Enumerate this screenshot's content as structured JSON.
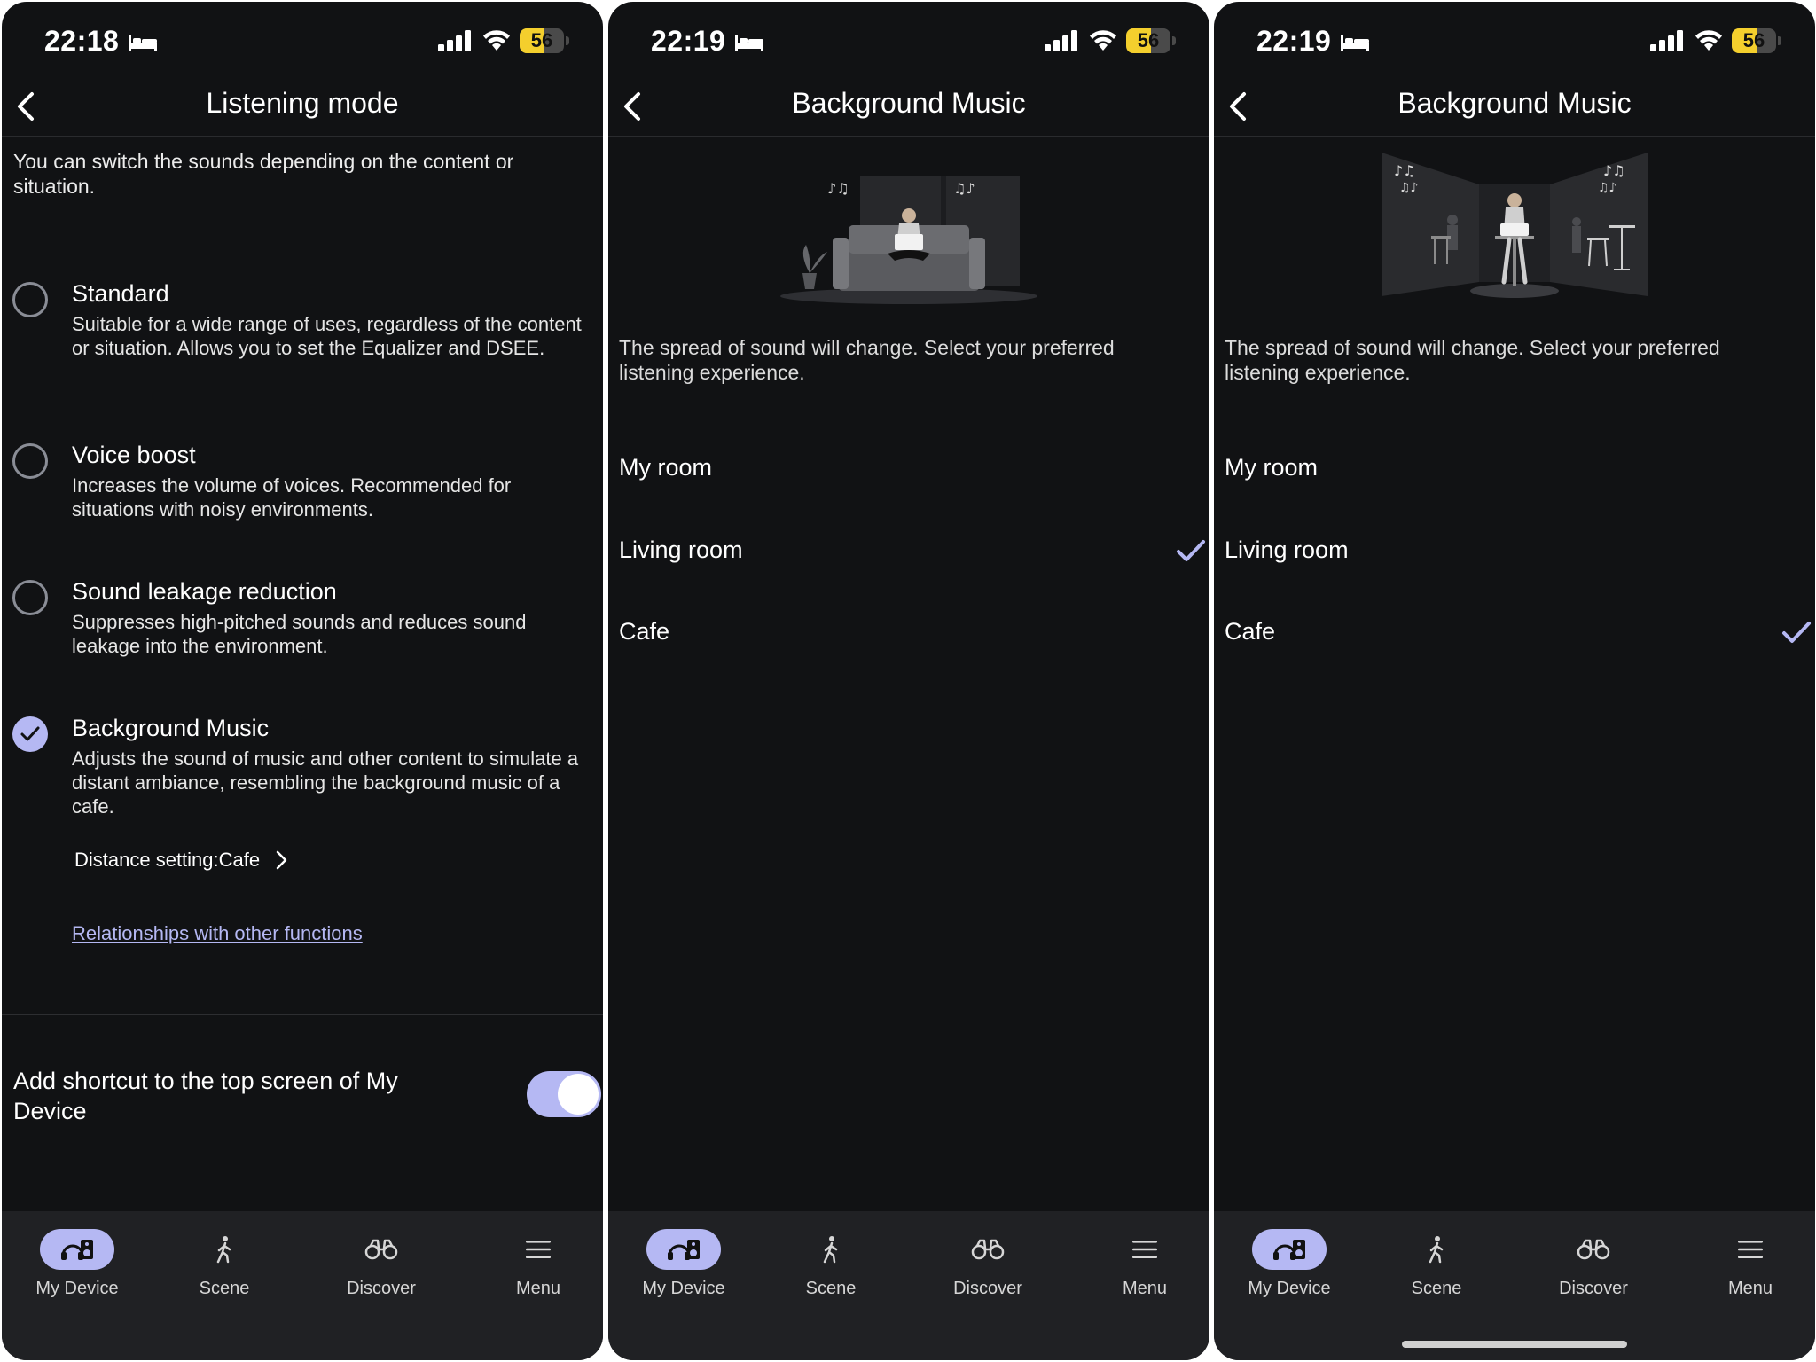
{
  "screens": [
    {
      "status": {
        "time": "22:18",
        "battery": "56"
      },
      "title": "Listening mode",
      "intro": "You can switch the sounds depending on the content or situation.",
      "options": [
        {
          "title": "Standard",
          "description": "Suitable for a wide range of uses, regardless of the content or situation. Allows you to set the Equalizer and DSEE.",
          "selected": false
        },
        {
          "title": "Voice boost",
          "description": "Increases the volume of voices. Recommended for situations with noisy environments.",
          "selected": false
        },
        {
          "title": "Sound leakage reduction",
          "description": "Suppresses high-pitched sounds and reduces sound leakage into the environment.",
          "selected": false
        },
        {
          "title": "Background Music",
          "description": "Adjusts the sound of music and other content to simulate a distant ambiance, resembling the background music of a cafe.",
          "selected": true
        }
      ],
      "distance_setting": "Distance setting:Cafe",
      "relationships_link": "Relationships with other functions",
      "shortcut_label": "Add shortcut to the top screen of My Device",
      "shortcut_enabled": true
    },
    {
      "status": {
        "time": "22:19",
        "battery": "56"
      },
      "title": "Background Music",
      "description": "The spread of sound will change. Select your preferred listening experience.",
      "rooms": [
        {
          "label": "My room",
          "selected": false
        },
        {
          "label": "Living room",
          "selected": true
        },
        {
          "label": "Cafe",
          "selected": false
        }
      ]
    },
    {
      "status": {
        "time": "22:19",
        "battery": "56"
      },
      "title": "Background Music",
      "description": "The spread of sound will change. Select your preferred listening experience.",
      "rooms": [
        {
          "label": "My room",
          "selected": false
        },
        {
          "label": "Living room",
          "selected": false
        },
        {
          "label": "Cafe",
          "selected": true
        }
      ]
    }
  ],
  "nav": [
    {
      "label": "My Device",
      "icon": "headphones-speaker-icon",
      "active": true
    },
    {
      "label": "Scene",
      "icon": "walking-person-icon",
      "active": false
    },
    {
      "label": "Discover",
      "icon": "binoculars-icon",
      "active": false
    },
    {
      "label": "Menu",
      "icon": "hamburger-menu-icon",
      "active": false
    }
  ],
  "colors": {
    "background": "#111214",
    "accent": "#b5b8f3",
    "nav_background": "#202124",
    "battery": "#f4cf2d"
  }
}
